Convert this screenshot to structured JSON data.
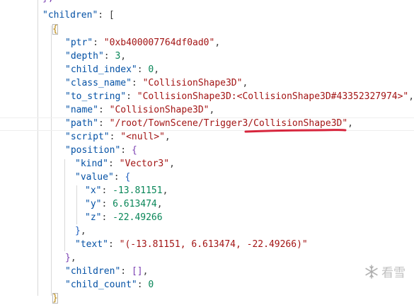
{
  "colors": {
    "key": "#0451a5",
    "string": "#a31515",
    "number": "#098658",
    "punctuation": "#3b3b3b",
    "annotation": "#d7263d"
  },
  "lines": {
    "l0": "},",
    "l1_key": "\"children\"",
    "l1_rest": ": [",
    "l2_brace": "{",
    "ptr_key": "\"ptr\"",
    "ptr_val": "\"0xb400007764df0ad0\"",
    "depth_key": "\"depth\"",
    "depth_val": "3",
    "child_index_key": "\"child_index\"",
    "child_index_val": "0",
    "class_name_key": "\"class_name\"",
    "class_name_val": "\"CollisionShape3D\"",
    "to_string_key": "\"to_string\"",
    "to_string_val": "\"CollisionShape3D:<CollisionShape3D#43352327974>\"",
    "name_key": "\"name\"",
    "name_val": "\"CollisionShape3D\"",
    "path_key": "\"path\"",
    "path_val": "\"/root/TownScene/Trigger3/CollisionShape3D\"",
    "script_key": "\"script\"",
    "script_val": "\"<null>\"",
    "position_key": "\"position\"",
    "kind_key": "\"kind\"",
    "kind_val": "\"Vector3\"",
    "value_key": "\"value\"",
    "x_key": "\"x\"",
    "x_val": "-13.81151",
    "y_key": "\"y\"",
    "y_val": "6.613474",
    "z_key": "\"z\"",
    "z_val": "-22.49266",
    "text_key": "\"text\"",
    "text_val": "\"(-13.81151, 6.613474, -22.49266)\"",
    "children_key": "\"children\"",
    "children_val": "[]",
    "child_count_key": "\"child_count\"",
    "child_count_val": "0",
    "last_brace": "}"
  },
  "watermark": {
    "icon": "snowflake-icon",
    "text": "看雪"
  }
}
